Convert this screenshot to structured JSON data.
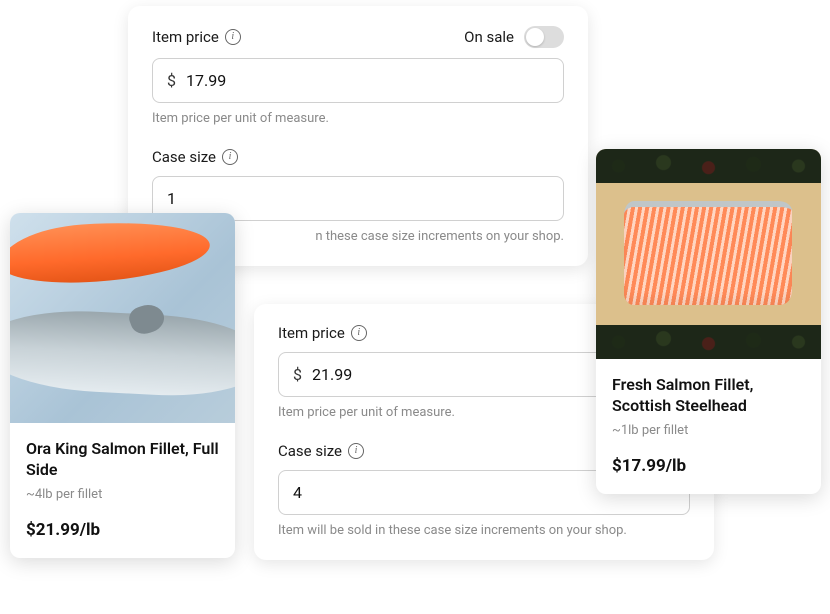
{
  "panel_top": {
    "item_price_label": "Item price",
    "on_sale_label": "On sale",
    "currency": "$",
    "price_value": "17.99",
    "price_helper": "Item price per unit of measure.",
    "case_size_label": "Case size",
    "case_size_value": "1",
    "case_size_helper_partial": "n these case size increments on your shop."
  },
  "panel_bottom": {
    "item_price_label": "Item price",
    "currency": "$",
    "price_value": "21.99",
    "price_helper": "Item price per unit of measure.",
    "case_size_label": "Case size",
    "case_size_value": "4",
    "case_size_helper": "Item will be sold in these case size increments on your shop."
  },
  "card_left": {
    "title": "Ora King Salmon Fillet, Full Side",
    "subtitle": "~4lb per fillet",
    "price": "$21.99/lb"
  },
  "card_right": {
    "title": "Fresh Salmon Fillet, Scottish Steelhead",
    "subtitle": "~1lb per fillet",
    "price": "$17.99/lb"
  }
}
